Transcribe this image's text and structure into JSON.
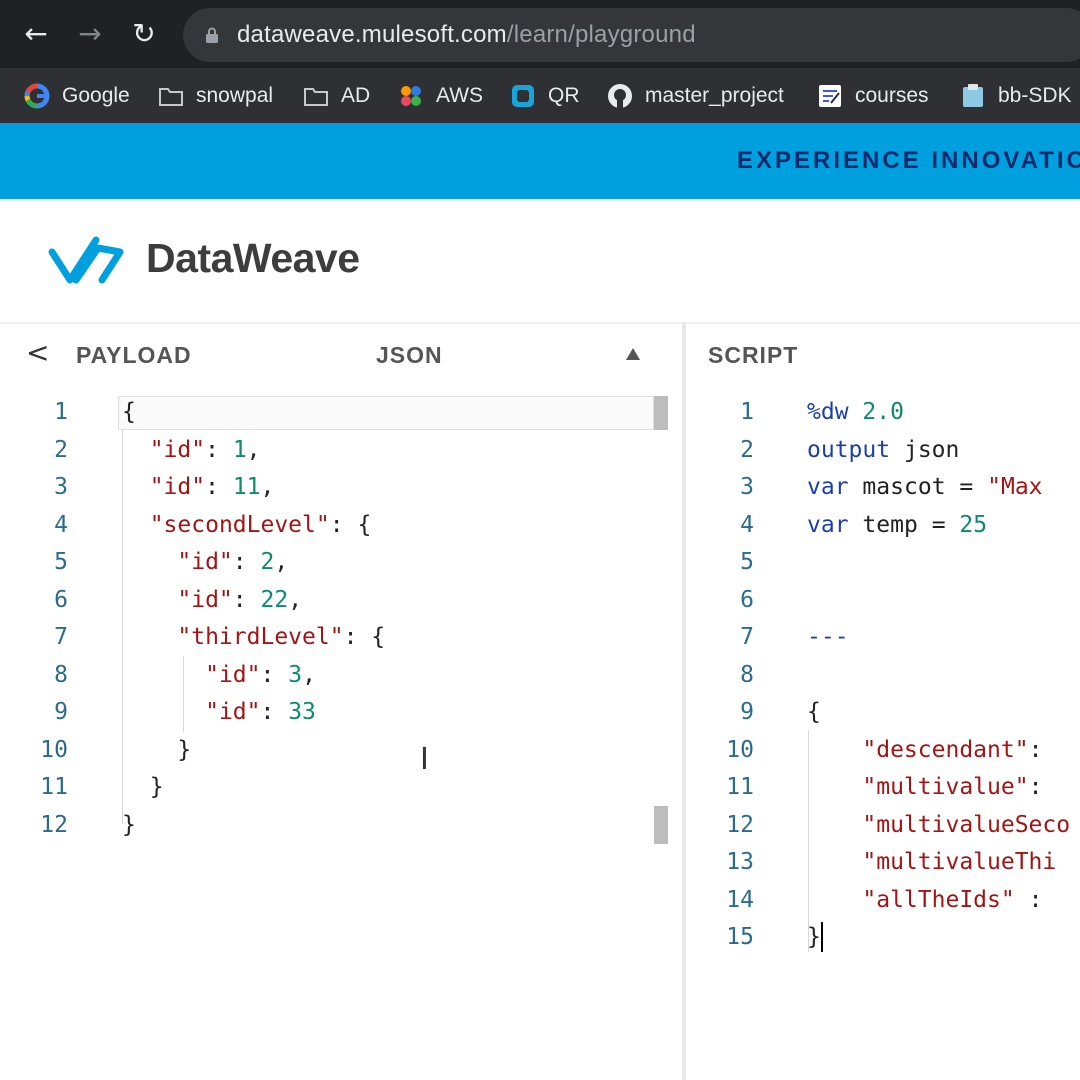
{
  "browser": {
    "url_host": "dataweave.mulesoft.com",
    "url_path": "/learn/playground",
    "bookmarks": [
      {
        "label": "Google",
        "icon": "google-icon"
      },
      {
        "label": "snowpal",
        "icon": "folder-icon"
      },
      {
        "label": "AD",
        "icon": "folder-icon"
      },
      {
        "label": "AWS",
        "icon": "aws-icon"
      },
      {
        "label": "QR",
        "icon": "qr-icon"
      },
      {
        "label": "master_project",
        "icon": "github-icon"
      },
      {
        "label": "courses",
        "icon": "notes-icon"
      },
      {
        "label": "bb-SDK",
        "icon": "clipboard-icon"
      }
    ]
  },
  "banner": {
    "text": "EXPERIENCE INNOVATIC"
  },
  "header": {
    "title": "DataWeave"
  },
  "payload_panel": {
    "collapse_icon": "<",
    "label": "PAYLOAD",
    "format": "JSON",
    "lines": [
      {
        "n": "1",
        "code": "{"
      },
      {
        "n": "2",
        "code": "  \"id\": 1,"
      },
      {
        "n": "3",
        "code": "  \"id\": 11,"
      },
      {
        "n": "4",
        "code": "  \"secondLevel\": {"
      },
      {
        "n": "5",
        "code": "    \"id\": 2,"
      },
      {
        "n": "6",
        "code": "    \"id\": 22,"
      },
      {
        "n": "7",
        "code": "    \"thirdLevel\": {"
      },
      {
        "n": "8",
        "code": "      \"id\": 3,"
      },
      {
        "n": "9",
        "code": "      \"id\": 33"
      },
      {
        "n": "10",
        "code": "    }"
      },
      {
        "n": "11",
        "code": "  }"
      },
      {
        "n": "12",
        "code": "}"
      }
    ]
  },
  "script_panel": {
    "label": "SCRIPT",
    "lines": [
      {
        "n": "1",
        "code": "%dw 2.0"
      },
      {
        "n": "2",
        "code": "output json"
      },
      {
        "n": "3",
        "code": "var mascot = \"Max"
      },
      {
        "n": "4",
        "code": "var temp = 25"
      },
      {
        "n": "5",
        "code": ""
      },
      {
        "n": "6",
        "code": ""
      },
      {
        "n": "7",
        "code": "---"
      },
      {
        "n": "8",
        "code": ""
      },
      {
        "n": "9",
        "code": "{"
      },
      {
        "n": "10",
        "code": "    \"descendant\": "
      },
      {
        "n": "11",
        "code": "    \"multivalue\": "
      },
      {
        "n": "12",
        "code": "    \"multivalueSeco"
      },
      {
        "n": "13",
        "code": "    \"multivalueThi"
      },
      {
        "n": "14",
        "code": "    \"allTheIds\" : "
      },
      {
        "n": "15",
        "code": "}"
      }
    ]
  },
  "colors": {
    "banner": "#00a0df",
    "keyword": "#1c3fb0",
    "string": "#a31515",
    "number": "#0e8a6e",
    "line_number": "#2b6b8f"
  }
}
